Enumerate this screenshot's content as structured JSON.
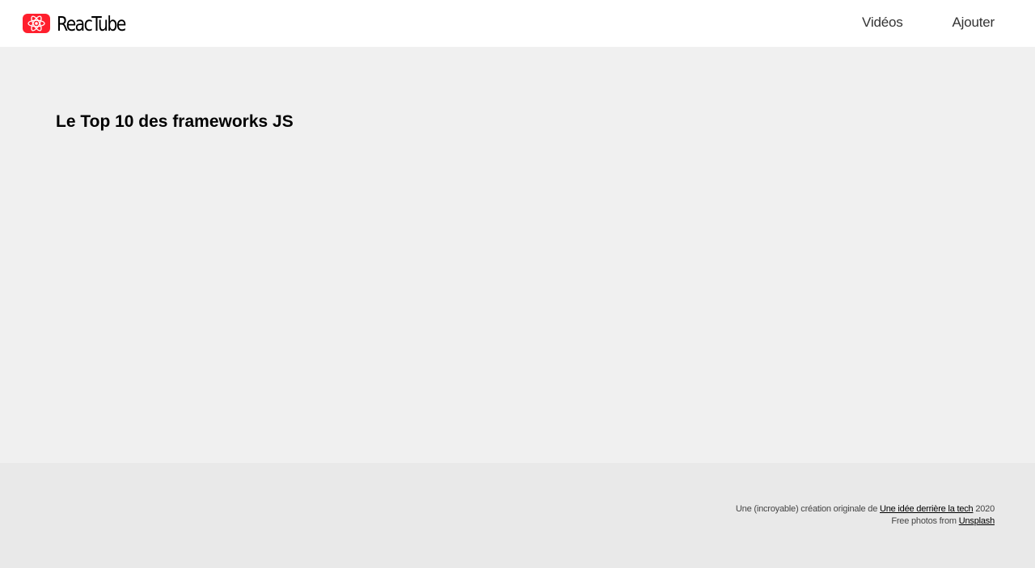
{
  "header": {
    "brand": "ReacTube",
    "logo_icon": "react-atom-icon",
    "brand_color": "#ff1f2d",
    "nav": [
      {
        "label": "Vidéos"
      },
      {
        "label": "Ajouter"
      }
    ]
  },
  "main": {
    "video_title": "Le Top 10 des frameworks JS"
  },
  "footer": {
    "line1_prefix": "Une (incroyable) création originale de ",
    "line1_link": "Une idée derrière la tech",
    "line1_suffix": " 2020",
    "line2_prefix": "Free photos from ",
    "line2_link": "Unsplash"
  }
}
